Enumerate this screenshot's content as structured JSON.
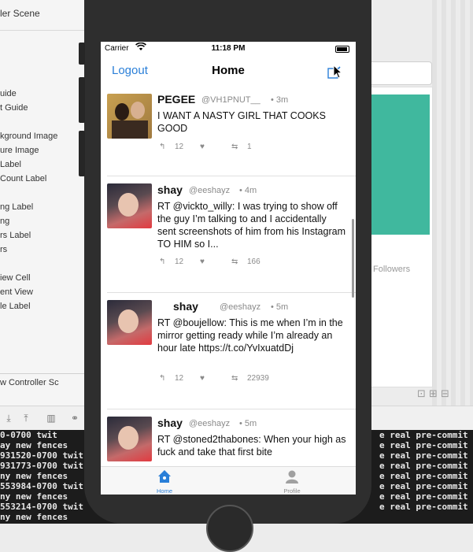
{
  "xcode": {
    "scene_title": "ler Scene",
    "outline_items": [
      "uide",
      "t Guide",
      "",
      "kground Image",
      "ure Image",
      "Label",
      "Count Label",
      "",
      "ng Label",
      "ng",
      "rs Label",
      "rs",
      "",
      "iew Cell",
      "ent View",
      "le Label"
    ],
    "controller_label": "w Controller Sc",
    "followers_label": "Followers",
    "console_left": [
      "0-0700 twit",
      "ay new fences",
      "931520-0700 twit",
      "931773-0700 twit",
      "ny new fences",
      "553984-0700 twit",
      "ny new fences",
      "553214-0700 twit",
      "ny new fences"
    ],
    "console_right": [
      "e real pre-commit h",
      "e real pre-commit h",
      "e real pre-commit h",
      "e real pre-commit h",
      "e real pre-commit h",
      "e real pre-commit h",
      "e real pre-commit h",
      "e real pre-commit h"
    ]
  },
  "status_bar": {
    "carrier": "Carrier",
    "time": "11:18 PM"
  },
  "nav": {
    "logout_label": "Logout",
    "title": "Home"
  },
  "tweets": [
    {
      "name": "PEGEE",
      "handle": "@VH1PNUT__",
      "age": "• 3m",
      "text": "I WANT A NASTY GIRL THAT COOKS GOOD",
      "replies": "",
      "likes_label": "12",
      "retweets": "1"
    },
    {
      "name": "shay",
      "handle": "@eeshayz",
      "age": "• 4m",
      "text": "RT @vickto_willy: I was trying to show off the guy I’m talking to and I accidentally sent screenshots of him from his Instagram TO HIM so I...",
      "likes_label": "12",
      "retweets": "166"
    },
    {
      "name": "shay",
      "handle": "@eeshayz",
      "age": "• 5m",
      "text": "RT @boujellow: This is me when I’m in the mirror getting ready while I’m already an hour late https://t.co/YvIxuatdDj",
      "likes_label": "12",
      "retweets": "22939"
    },
    {
      "name": "shay",
      "handle": "@eeshayz",
      "age": "• 5m",
      "text": "RT @stoned2thabones: When your high as fuck and take that first bite",
      "likes_label": "",
      "retweets": ""
    }
  ],
  "tabs": [
    {
      "label": "Home",
      "color": "#2a7fd8"
    },
    {
      "label": "Profile",
      "color": "#8e8e8e"
    }
  ],
  "colors": {
    "accent": "#2a7fd8",
    "teal": "#40b89e"
  }
}
